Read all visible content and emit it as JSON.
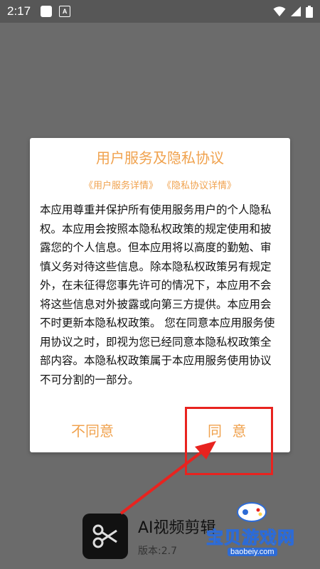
{
  "status_bar": {
    "time": "2:17",
    "notification_icon": "app-notification-square",
    "accessibility_icon": "A",
    "wifi_icon": "wifi-icon",
    "signal_icon": "signal-icon",
    "battery_icon": "battery-icon"
  },
  "dialog": {
    "title": "用户服务及隐私协议",
    "links": [
      "《用户服务详情》",
      "《隐私协议详情》"
    ],
    "body": "本应用尊重并保护所有使用服务用户的个人隐私权。本应用会按照本隐私权政策的规定使用和披露您的个人信息。但本应用将以高度的勤勉、审慎义务对待这些信息。除本隐私权政策另有规定外，在未征得您事先许可的情况下，本应用不会将这些信息对外披露或向第三方提供。本应用会不时更新本隐私权政策。 您在同意本应用服务使用协议之时，即视为您已经同意本隐私权政策全部内容。本隐私权政策属于本应用服务使用协议不可分割的一部分。",
    "disagree_label": "不同意",
    "agree_label": "同 意"
  },
  "background_app": {
    "name": "AI视频剪辑",
    "version": "版本:2.7"
  },
  "watermark": {
    "name": "宝贝游戏网",
    "url": "baobeiy.com"
  },
  "colors": {
    "accent": "#f0a24e",
    "annotation": "#e8231f",
    "overlay": "#6b6b6b"
  }
}
